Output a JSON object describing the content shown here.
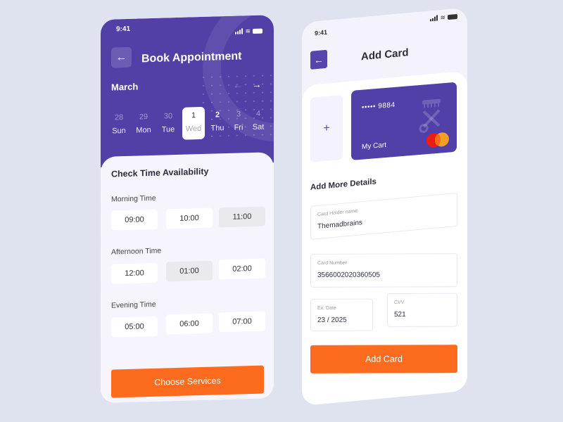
{
  "colors": {
    "background": "#dfe2ef",
    "primary_purple": "#5340a6",
    "accent_orange": "#fd6b1f",
    "surface": "#f6f5fd"
  },
  "book_screen": {
    "status": {
      "time": "9:41",
      "icons": [
        "signal-icon",
        "wifi-icon",
        "battery-icon"
      ]
    },
    "back_icon": "arrow-left-icon",
    "title": "Book Appointment",
    "month": "March",
    "prev_icon": "arrow-left-icon",
    "next_icon": "arrow-right-icon",
    "days": [
      {
        "num": "28",
        "name": "Sun",
        "state": "past"
      },
      {
        "num": "29",
        "name": "Mon",
        "state": "past"
      },
      {
        "num": "30",
        "name": "Tue",
        "state": "past"
      },
      {
        "num": "1",
        "name": "Wed",
        "state": "selected"
      },
      {
        "num": "2",
        "name": "Thu",
        "state": "available"
      },
      {
        "num": "3",
        "name": "Fri",
        "state": "available"
      },
      {
        "num": "4",
        "name": "Sat",
        "state": "available"
      }
    ],
    "section_title": "Check Time Availability",
    "groups": [
      {
        "label": "Morning Time",
        "slots": [
          "09:00",
          "10:00",
          "11:00"
        ],
        "selected": "11:00"
      },
      {
        "label": "Afternoon Time",
        "slots": [
          "12:00",
          "01:00",
          "02:00"
        ],
        "selected": "01:00"
      },
      {
        "label": "Evening Time",
        "slots": [
          "05:00",
          "06:00",
          "07:00"
        ],
        "selected": null
      }
    ],
    "cta": "Choose Services"
  },
  "card_screen": {
    "status": {
      "time": "9:41",
      "icons": [
        "signal-icon",
        "wifi-icon",
        "battery-icon"
      ]
    },
    "back_icon": "arrow-left-icon",
    "title": "Add Card",
    "add_tile": "+",
    "card": {
      "masked_number": "••••• 9884",
      "name": "My Cart",
      "brand": "mastercard"
    },
    "section_title": "Add More Details",
    "fields": {
      "holder": {
        "label": "Card Holder name",
        "value": "Themadbrains"
      },
      "number": {
        "label": "Card Number",
        "value": "3566002020360505"
      },
      "expiry": {
        "label": "Ex. Date",
        "value": "23 / 2025"
      },
      "cvv": {
        "label": "CVV",
        "value": "521"
      }
    },
    "cta": "Add Card"
  },
  "glyphs": {
    "back": "←",
    "next": "→",
    "wifi": "≋"
  }
}
